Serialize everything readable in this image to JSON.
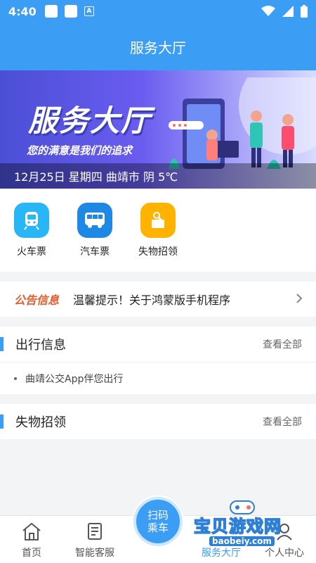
{
  "status_bar": {
    "time": "4:40",
    "badge": "A"
  },
  "header": {
    "title": "服务大厅"
  },
  "banner": {
    "title": "服务大厅",
    "subtitle": "您的满意是我们的追求",
    "info": "12月25日 星期四 曲靖市 阴 5℃"
  },
  "quick_actions": [
    {
      "label": "火车票",
      "icon": "train-icon",
      "color": "#29b6f6"
    },
    {
      "label": "汽车票",
      "icon": "bus-icon",
      "color": "#1e88e5"
    },
    {
      "label": "失物招领",
      "icon": "lost-found-icon",
      "color": "#ffb300"
    }
  ],
  "notice": {
    "tag": "公告信息",
    "text": "温馨提示！关于鸿蒙版手机程序"
  },
  "travel": {
    "title": "出行信息",
    "more": "查看全部",
    "items": [
      "曲靖公交App伴您出行"
    ]
  },
  "lost_found": {
    "title": "失物招领",
    "more": "查看全部"
  },
  "bottom_nav": {
    "home": "首页",
    "service": "智能客服",
    "hall": "服务大厅",
    "profile": "个人中心",
    "scan_line1": "扫码",
    "scan_line2": "乘车"
  },
  "watermark": {
    "text": "宝贝游戏网",
    "url": "baobeiy.com"
  },
  "colors": {
    "primary": "#3b9df3",
    "notice_tag": "#e45b2d"
  }
}
